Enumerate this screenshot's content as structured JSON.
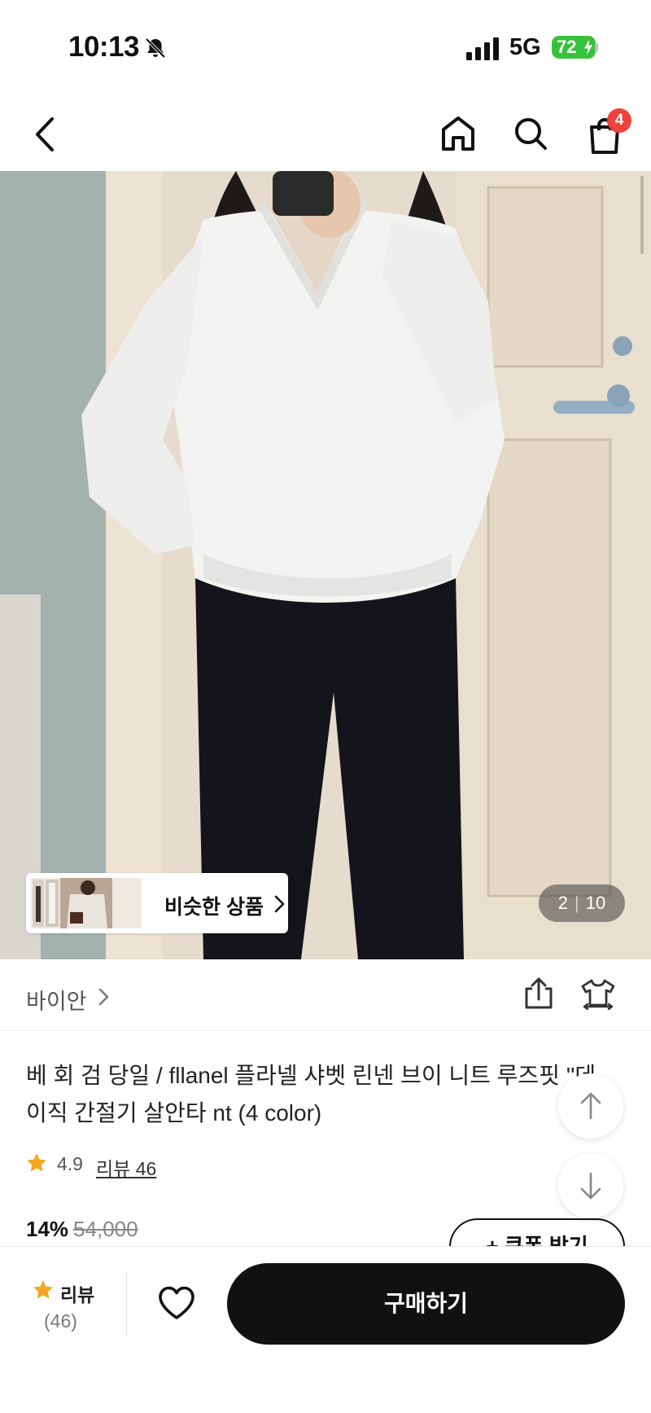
{
  "status_bar": {
    "time": "10:13",
    "network": "5G",
    "battery": "72",
    "icons": [
      "bell-slash-icon",
      "signal-icon",
      "battery-charging-icon"
    ]
  },
  "nav": {
    "icons": [
      "back-icon",
      "home-icon",
      "search-icon",
      "shopping-bag-icon"
    ],
    "cart_count": "4"
  },
  "gallery": {
    "similar_label": "비슷한 상품",
    "counter_current": "2",
    "counter_total": "10"
  },
  "brand": {
    "name": "바이안",
    "icons": [
      "share-icon",
      "fit-compare-icon"
    ]
  },
  "product": {
    "title": "베 회 검 당일 / fllanel 플라넬 샤벳 린넨 브이 니트 루즈핏 ''데이직 간절기 살안타 nt (4 color)",
    "rating": "4.9",
    "review_link": "리뷰 46",
    "discount": "14%",
    "original_price": "54,000",
    "coupon_label": "+ 쿠폰 받기"
  },
  "bottom_bar": {
    "review_label": "리뷰",
    "review_count": "(46)",
    "buy_label": "구매하기"
  },
  "colors": {
    "accent": "#111111",
    "badge": "#f0413a",
    "star": "#f5a623",
    "battery": "#38c13d"
  }
}
